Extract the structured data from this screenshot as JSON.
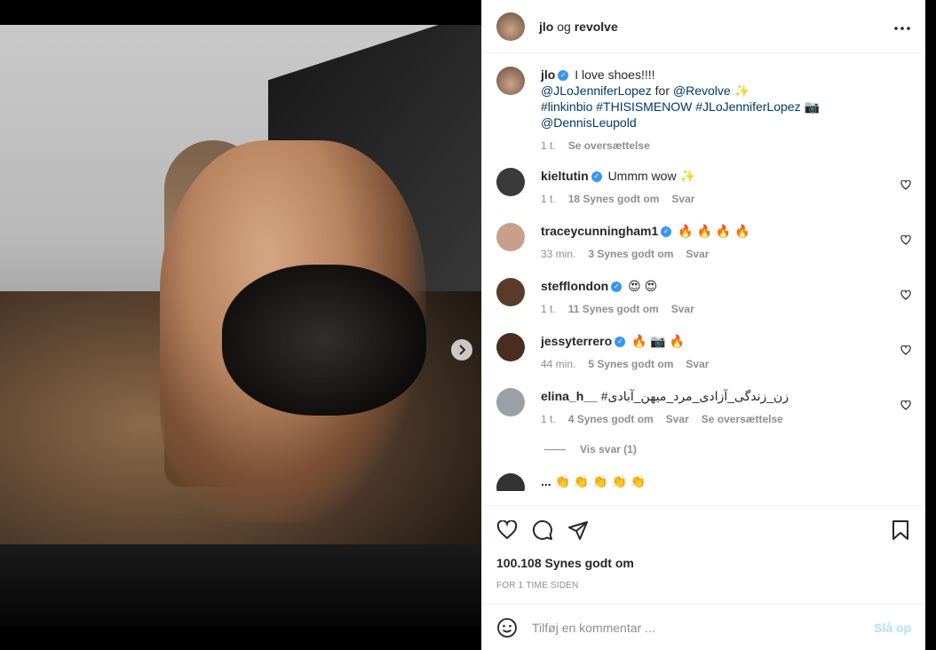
{
  "header": {
    "username": "jlo",
    "connector": " og ",
    "collaborator": "revolve",
    "more_icon": "more-horizontal-icon"
  },
  "media": {
    "next_icon": "chevron-right-icon",
    "slide_count": 10,
    "active_slide": 1
  },
  "caption": {
    "user": "jlo",
    "line1": "I love shoes!!!!",
    "line2a": "@JLoJenniferLopez",
    "line2b": " for ",
    "line2c": "@Revolve",
    "line2d": " ✨",
    "line3": "#linkinbio #THISISMENOW #JLoJenniferLopez",
    "line3_emoji": "📷",
    "line4": "@DennisLeupold",
    "time": "1 t.",
    "translate": "Se oversættelse"
  },
  "comments": [
    {
      "user": "kieltutin",
      "verified": true,
      "text": "Ummm wow ✨",
      "time": "1 t.",
      "likes": "18 Synes godt om",
      "reply": "Svar",
      "extra": ""
    },
    {
      "user": "traceycunningham1",
      "verified": true,
      "text": "🔥 🔥 🔥 🔥",
      "time": "33 min.",
      "likes": "3 Synes godt om",
      "reply": "Svar",
      "extra": ""
    },
    {
      "user": "stefflondon",
      "verified": true,
      "text": "😍 😍",
      "time": "1 t.",
      "likes": "11 Synes godt om",
      "reply": "Svar",
      "extra": ""
    },
    {
      "user": "jessyterrero",
      "verified": true,
      "text": "🔥 📷 🔥",
      "time": "44 min.",
      "likes": "5 Synes godt om",
      "reply": "Svar",
      "extra": ""
    },
    {
      "user": "elina_h__",
      "verified": false,
      "text": "#زن_زندگی_آزادی_مرد_میهن_آبادی",
      "time": "1 t.",
      "likes": "4 Synes godt om",
      "reply": "Svar",
      "extra": "Se oversættelse"
    }
  ],
  "view_replies": "Vis svar (1)",
  "partial_comment": {
    "user": "...",
    "text": "👏 👏 👏 👏 👏"
  },
  "actions": {
    "like_icon": "heart-icon",
    "comment_icon": "comment-icon",
    "share_icon": "send-icon",
    "save_icon": "bookmark-icon"
  },
  "likes": "100.108 Synes godt om",
  "timestamp": "FOR 1 TIME SIDEN",
  "add_comment": {
    "emoji_icon": "smiley-icon",
    "placeholder": "Tilføj en kommentar ...",
    "post_label": "Slå op"
  },
  "colors": {
    "link": "#00376b",
    "muted": "#8e8e8e",
    "verified": "#3897f0",
    "post_disabled": "#b2dffc"
  }
}
